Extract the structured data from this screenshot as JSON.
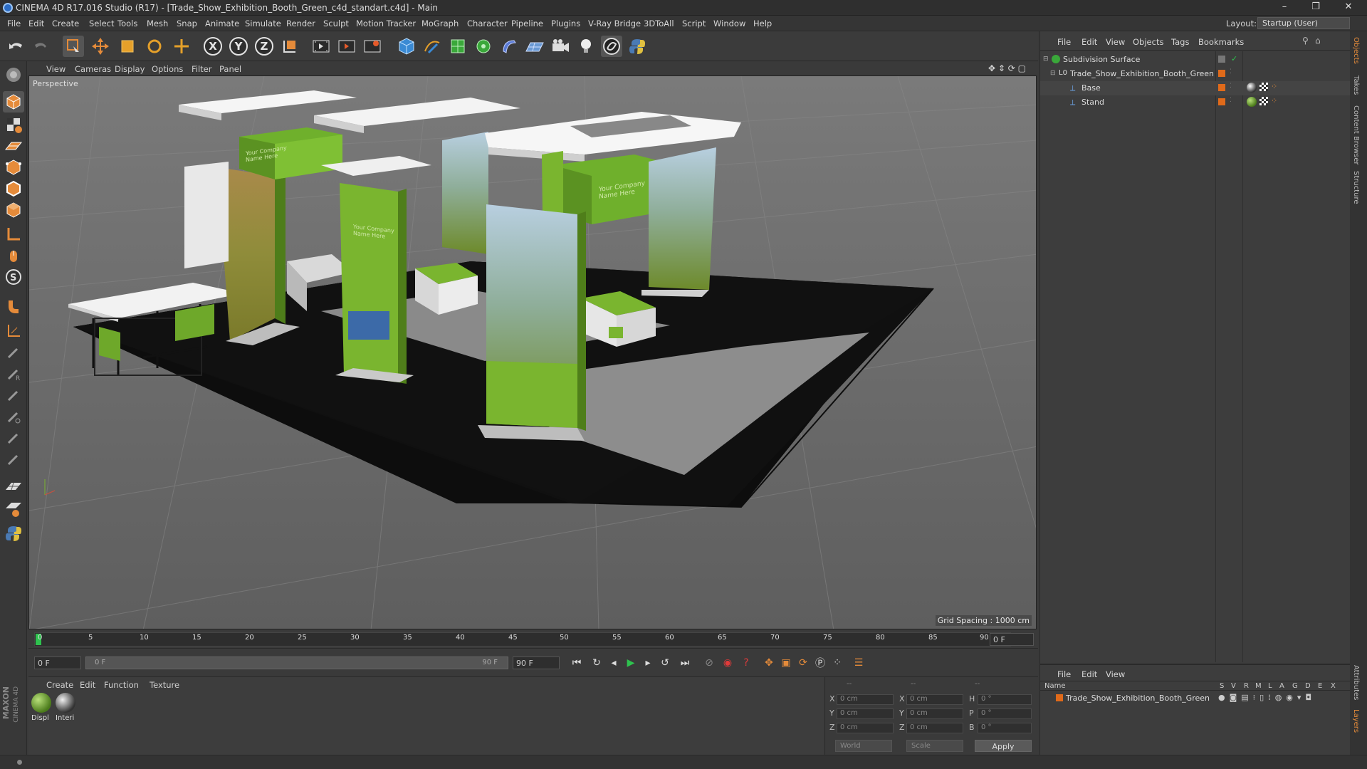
{
  "window": {
    "title": "CINEMA 4D R17.016 Studio (R17) - [Trade_Show_Exhibition_Booth_Green_c4d_standart.c4d] - Main",
    "minimize": "–",
    "restore": "❐",
    "close": "✕"
  },
  "menubar": {
    "items": [
      "File",
      "Edit",
      "Create",
      "Select",
      "Tools",
      "Mesh",
      "Snap",
      "Animate",
      "Simulate",
      "Render",
      "Sculpt",
      "Motion Tracker",
      "MoGraph",
      "Character",
      "Pipeline",
      "Plugins",
      "V-Ray Bridge",
      "3DToAll",
      "Script",
      "Window",
      "Help"
    ],
    "layout_label": "Layout:",
    "layout_value": "Startup (User)"
  },
  "toolbar": {
    "axis_x": "X",
    "axis_y": "Y",
    "axis_z": "Z"
  },
  "viewport": {
    "menu": [
      "View",
      "Cameras",
      "Display",
      "Options",
      "Filter",
      "Panel"
    ],
    "label": "Perspective",
    "grid_spacing": "Grid Spacing : 1000 cm",
    "booth_sign_text": "Your Company Name Here"
  },
  "timeline": {
    "ticks": [
      "0",
      "5",
      "10",
      "15",
      "20",
      "25",
      "30",
      "35",
      "40",
      "45",
      "50",
      "55",
      "60",
      "65",
      "70",
      "75",
      "80",
      "85",
      "90"
    ],
    "current_frame": "0 F"
  },
  "transport": {
    "start_frame": "0 F",
    "range_start": "0 F",
    "range_end": "90 F",
    "end_frame": "90 F"
  },
  "material_manager": {
    "menu": [
      "Create",
      "Edit",
      "Function",
      "Texture"
    ],
    "materials": [
      {
        "label": "Displ",
        "color": "#5a8a2a"
      },
      {
        "label": "Interi",
        "color": "#5a5a5a"
      }
    ]
  },
  "coordinates": {
    "header": [
      "--",
      "--",
      "--"
    ],
    "rows": [
      {
        "pos_label": "X",
        "pos": "0 cm",
        "size_label": "X",
        "size": "0 cm",
        "rot_label": "H",
        "rot": "0 °"
      },
      {
        "pos_label": "Y",
        "pos": "0 cm",
        "size_label": "Y",
        "size": "0 cm",
        "rot_label": "P",
        "rot": "0 °"
      },
      {
        "pos_label": "Z",
        "pos": "0 cm",
        "size_label": "Z",
        "size": "0 cm",
        "rot_label": "B",
        "rot": "0 °"
      }
    ],
    "mode": "World",
    "size_mode": "Scale",
    "apply": "Apply"
  },
  "object_manager": {
    "menu": [
      "File",
      "Edit",
      "View",
      "Objects",
      "Tags",
      "Bookmarks"
    ],
    "objects": [
      {
        "name": "Subdivision Surface",
        "indent": 0
      },
      {
        "name": "Trade_Show_Exhibition_Booth_Green",
        "indent": 1
      },
      {
        "name": "Base",
        "indent": 2
      },
      {
        "name": "Stand",
        "indent": 2
      }
    ]
  },
  "layer_manager": {
    "menu": [
      "File",
      "Edit",
      "View"
    ],
    "columns": [
      "Name",
      "S",
      "V",
      "R",
      "M",
      "L",
      "A",
      "G",
      "D",
      "E",
      "X"
    ],
    "layers": [
      {
        "name": "Trade_Show_Exhibition_Booth_Green",
        "color": "#e06a1a"
      }
    ]
  },
  "side_tabs": [
    "Objects",
    "Takes",
    "Content Browser",
    "Structure"
  ],
  "side_tabs_bottom": [
    "Attributes",
    "Layers"
  ],
  "brand": {
    "line1": "MAXON",
    "line2": "CINEMA 4D"
  },
  "colors": {
    "accent": "#e58b3a",
    "booth_green": "#7ab52f"
  }
}
